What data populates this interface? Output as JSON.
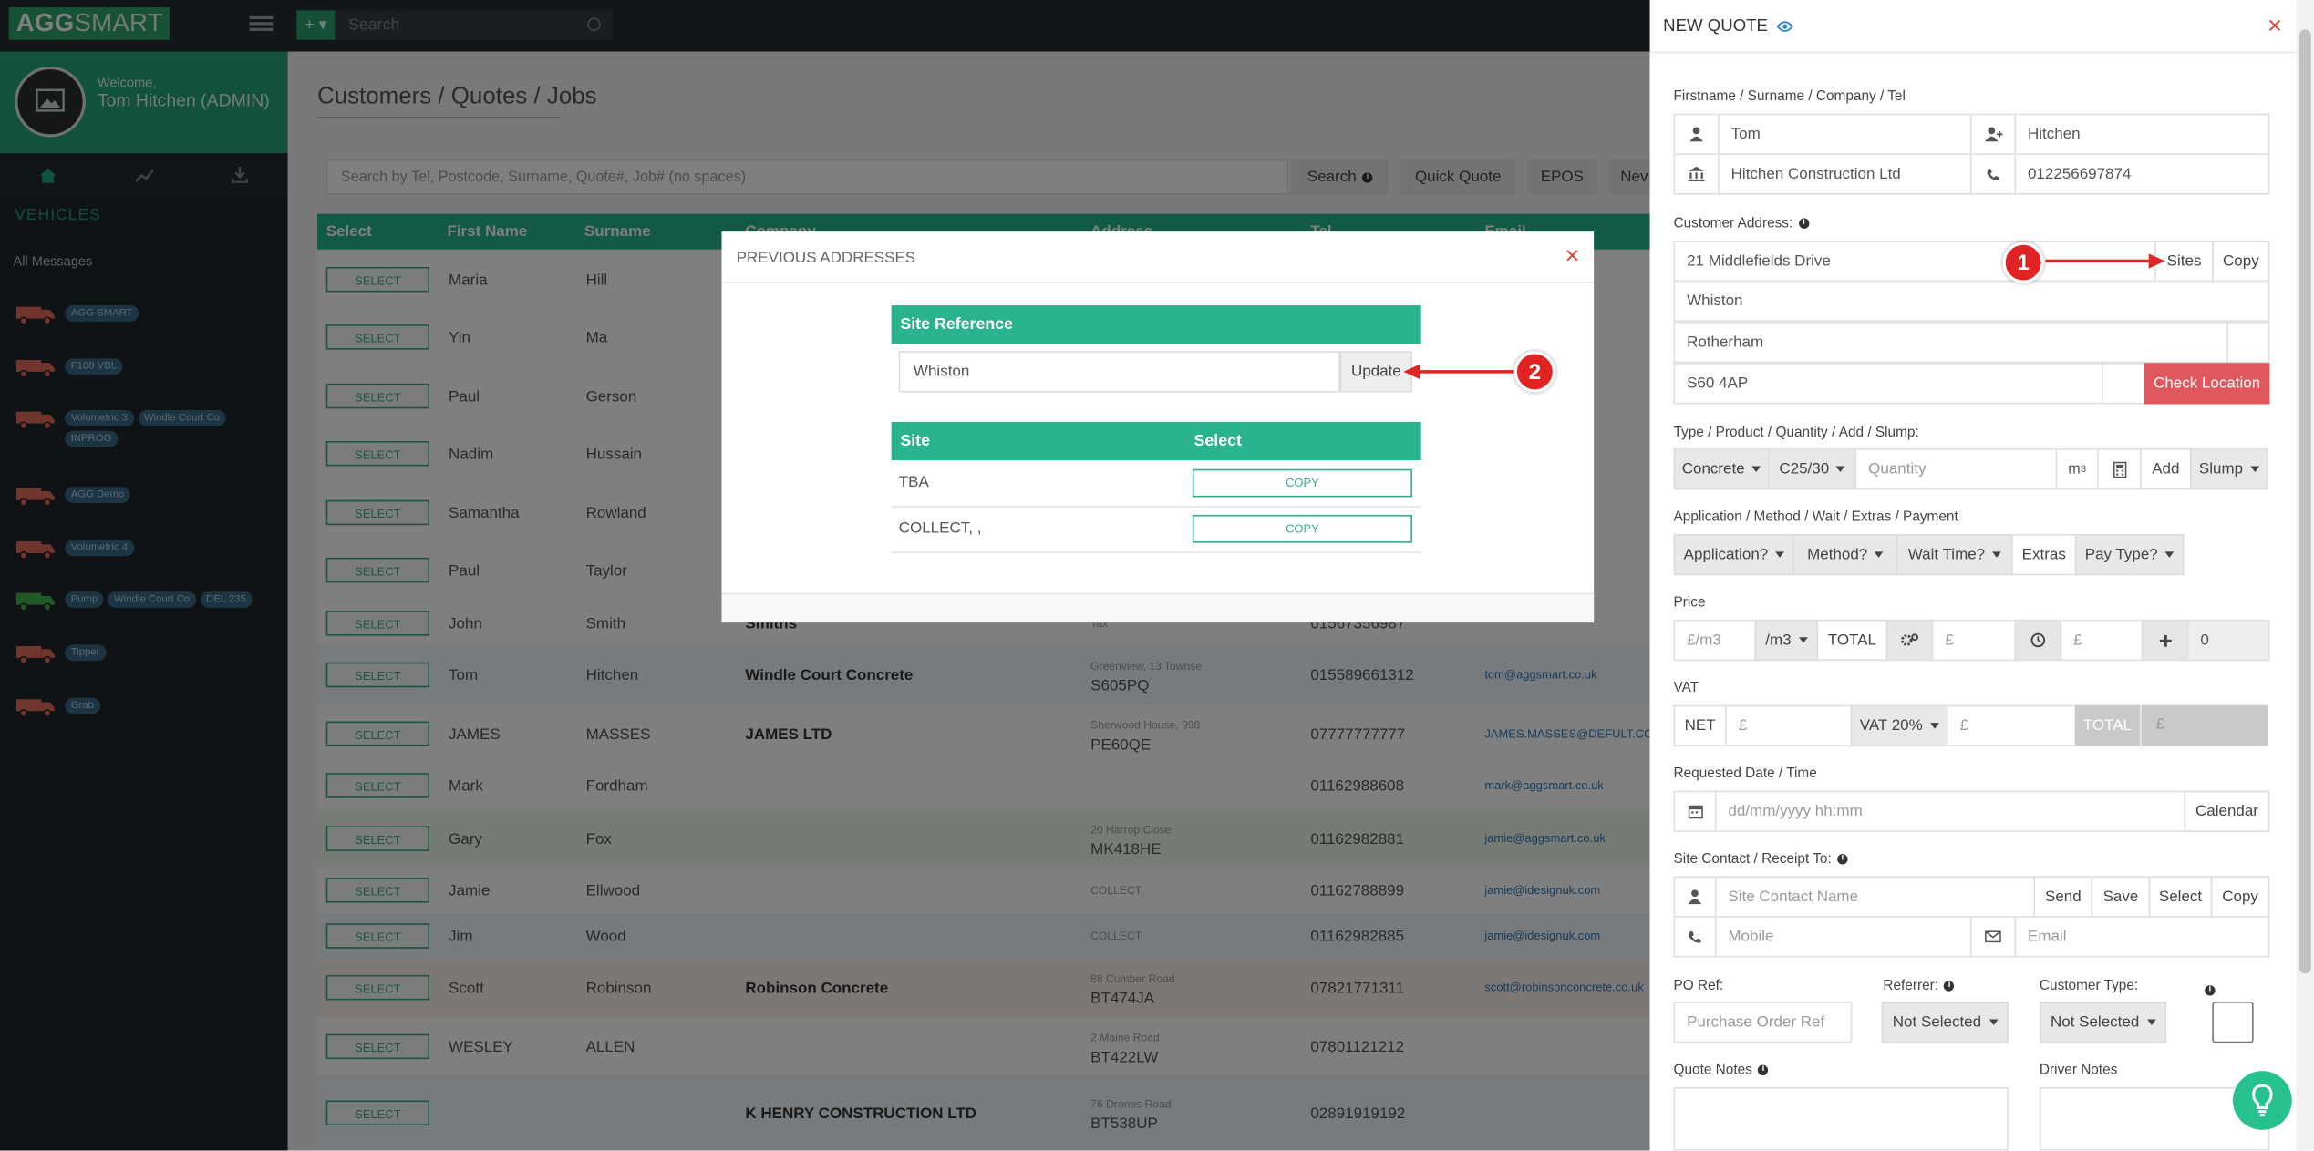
{
  "app": {
    "logo_bold": "AGG",
    "logo_rest": "SMART",
    "search_placeholder": "Search"
  },
  "sidebar": {
    "welcome": "Welcome,",
    "user": "Tom Hitchen (ADMIN)",
    "section_title": "VEHICLES",
    "all_messages": "All Messages",
    "vehicles": [
      {
        "color": "#e06a5a",
        "tags": [
          "AGG SMART"
        ]
      },
      {
        "color": "#e06a5a",
        "tags": [
          "F108 VBL"
        ]
      },
      {
        "color": "#e06a5a",
        "tags": [
          "Volumetric 3",
          "Windle Court Co",
          "INPROG"
        ]
      },
      {
        "color": "#e06a5a",
        "tags": [
          "AGG Demo"
        ]
      },
      {
        "color": "#e06a5a",
        "tags": [
          "Volumetric 4"
        ]
      },
      {
        "color": "#3fb54a",
        "tags": [
          "Pump",
          "Windle Court Co",
          "DEL 235"
        ]
      },
      {
        "color": "#e06a5a",
        "tags": [
          "Tipper"
        ]
      },
      {
        "color": "#e06a5a",
        "tags": [
          "Grab"
        ]
      }
    ]
  },
  "main": {
    "title": "Customers / Quotes / Jobs",
    "search_placeholder": "Search by Tel, Postcode, Surname, Quote#, Job# (no spaces)",
    "buttons": {
      "search": "Search",
      "quick_quote": "Quick Quote",
      "epos": "EPOS",
      "new": "Nev"
    },
    "columns": [
      "Select",
      "First Name",
      "Surname",
      "Company",
      "Address",
      "Tel",
      "Email"
    ],
    "select_label": "SELECT",
    "rows": [
      {
        "first": "Maria",
        "last": "Hill",
        "company": "",
        "addr1": "",
        "addr2": "",
        "tel": "",
        "email": "",
        "bg": "#ffffff"
      },
      {
        "first": "Yin",
        "last": "Ma",
        "company": "",
        "addr1": "",
        "addr2": "",
        "tel": "",
        "email": "",
        "bg": "#ffffff"
      },
      {
        "first": "Paul",
        "last": "Gerson",
        "company": "",
        "addr1": "",
        "addr2": "",
        "tel": "",
        "email": "",
        "bg": "#ffffff"
      },
      {
        "first": "Nadim",
        "last": "Hussain",
        "company": "",
        "addr1": "",
        "addr2": "",
        "tel": "",
        "email": "",
        "bg": "#ffffff"
      },
      {
        "first": "Samantha",
        "last": "Rowland",
        "company": "",
        "addr1": "",
        "addr2": "",
        "tel": "",
        "email": "",
        "bg": "#ffffff"
      },
      {
        "first": "Paul",
        "last": "Taylor",
        "company": "",
        "addr1": "",
        "addr2": "",
        "tel": "",
        "email": "",
        "bg": "#ffffff"
      },
      {
        "first": "John",
        "last": "Smith",
        "company": "Smiths",
        "addr1": "",
        "addr2": "Tax",
        "tel": "01567356987",
        "email": "",
        "bg": "#ffffff"
      },
      {
        "first": "Tom",
        "last": "Hitchen",
        "company": "Windle Court Concrete",
        "addr1": "Greenview, 13 Townse",
        "addr2": "S605PQ",
        "tel": "015589661312",
        "email": "tom@aggsmart.co.uk",
        "bg": "#eef6fb"
      },
      {
        "first": "JAMES",
        "last": "MASSES",
        "company": "JAMES LTD",
        "addr1": "Sherwood House, 998",
        "addr2": "PE60QE",
        "tel": "07777777777",
        "email": "JAMES.MASSES@DEFULT.CO.UK",
        "bg": "#ffffff"
      },
      {
        "first": "Mark",
        "last": "Fordham",
        "company": "",
        "addr1": "",
        "addr2": "",
        "tel": "01162988608",
        "email": "mark@aggsmart.co.uk",
        "bg": "#ffffff"
      },
      {
        "first": "Gary",
        "last": "Fox",
        "company": "",
        "addr1": "20 Harrop Close",
        "addr2": "MK418HE",
        "tel": "01162982881",
        "email": "jamie@aggsmart.co.uk",
        "bg": "#eef7ea"
      },
      {
        "first": "Jamie",
        "last": "Ellwood",
        "company": "",
        "addr1": "",
        "addr2": "COLLECT",
        "tel": "01162788899",
        "email": "jamie@idesignuk.com",
        "bg": "#ffffff"
      },
      {
        "first": "Jim",
        "last": "Wood",
        "company": "",
        "addr1": "",
        "addr2": "COLLECT",
        "tel": "01162982885",
        "email": "jamie@idesignuk.com",
        "bg": "#eef6fb"
      },
      {
        "first": "Scott",
        "last": "Robinson",
        "company": "Robinson Concrete",
        "addr1": "88 Cumber Road",
        "addr2": "BT474JA",
        "tel": "07821771311",
        "email": "scott@robinsonconcrete.co.uk",
        "bg": "#fbefec"
      },
      {
        "first": "WESLEY",
        "last": "ALLEN",
        "company": "",
        "addr1": "2 Maine Road",
        "addr2": "BT422LW",
        "tel": "07801121212",
        "email": "",
        "bg": "#ffffff"
      },
      {
        "first": "",
        "last": "",
        "company": "K HENRY CONSTRUCTION LTD",
        "addr1": "76 Drones Road",
        "addr2": "BT538UP",
        "tel": "02891919192",
        "email": "",
        "bg": "#eef6fb"
      }
    ]
  },
  "modal": {
    "title": "PREVIOUS ADDRESSES",
    "site_reference_header": "Site Reference",
    "site_reference_value": "Whiston",
    "update_label": "Update",
    "sites_header": "Site",
    "select_header": "Select",
    "copy_label": "COPY",
    "sites": [
      "TBA",
      "COLLECT, ,"
    ]
  },
  "quote": {
    "title": "NEW QUOTE",
    "name_label": "Firstname / Surname / Company / Tel",
    "firstname": "Tom",
    "surname": "Hitchen",
    "company": "Hitchen Construction Ltd",
    "tel": "012256697874",
    "address_label": "Customer Address:",
    "address1": "21 Middlefields Drive",
    "sites_btn": "Sites",
    "copy_btn": "Copy",
    "address2": "Whiston",
    "address3": "Rotherham",
    "postcode": "S60 4AP",
    "check_location": "Check Location",
    "type_label": "Type / Product / Quantity / Add / Slump:",
    "type": "Concrete",
    "product": "C25/30",
    "quantity_placeholder": "Quantity",
    "unit": "m",
    "unit_sup": "3",
    "add": "Add",
    "slump": "Slump",
    "app_label": "Application / Method / Wait / Extras / Payment",
    "application": "Application?",
    "method": "Method?",
    "wait": "Wait Time?",
    "extras": "Extras",
    "pay": "Pay Type?",
    "price_label": "Price",
    "price_placeholder": "£/m3",
    "per": "/m3",
    "total": "TOTAL",
    "pound1": "£",
    "pound2": "£",
    "zero": "0",
    "vat_label": "VAT",
    "net": "NET",
    "net_placeholder": "£",
    "vat_rate": "VAT 20%",
    "vat_placeholder": "£",
    "total2": "TOTAL",
    "total_placeholder": "£",
    "date_label": "Requested Date / Time",
    "date_placeholder": "dd/mm/yyyy hh:mm",
    "calendar": "Calendar",
    "contact_label": "Site Contact / Receipt To:",
    "contact_placeholder": "Site Contact Name",
    "send": "Send",
    "save": "Save",
    "select": "Select",
    "copy2": "Copy",
    "mobile_placeholder": "Mobile",
    "email_placeholder": "Email",
    "po_label": "PO Ref:",
    "po_placeholder": "Purchase Order Ref",
    "referrer_label": "Referrer:",
    "referrer": "Not Selected",
    "cust_type_label": "Customer Type:",
    "cust_type": "Not Selected",
    "quote_notes": "Quote Notes",
    "driver_notes": "Driver Notes"
  },
  "annotations": {
    "marker1": "1",
    "marker2": "2",
    "arrow_color": "#e02424"
  }
}
